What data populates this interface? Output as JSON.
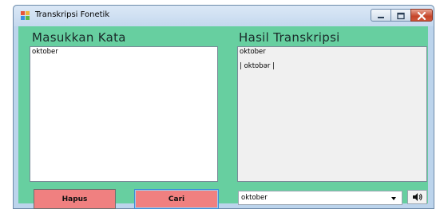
{
  "window": {
    "title": "Transkripsi Fonetik"
  },
  "left_panel": {
    "heading": "Masukkan Kata",
    "input_text": "oktober"
  },
  "right_panel": {
    "heading": "Hasil Transkripsi",
    "result_line1": "oktober",
    "result_line2": "| oktobər |"
  },
  "buttons": {
    "hapus_label": "Hapus",
    "cari_label": "Cari"
  },
  "word_select": {
    "selected": "oktober"
  },
  "icons": {
    "speaker": "speaker-icon"
  }
}
